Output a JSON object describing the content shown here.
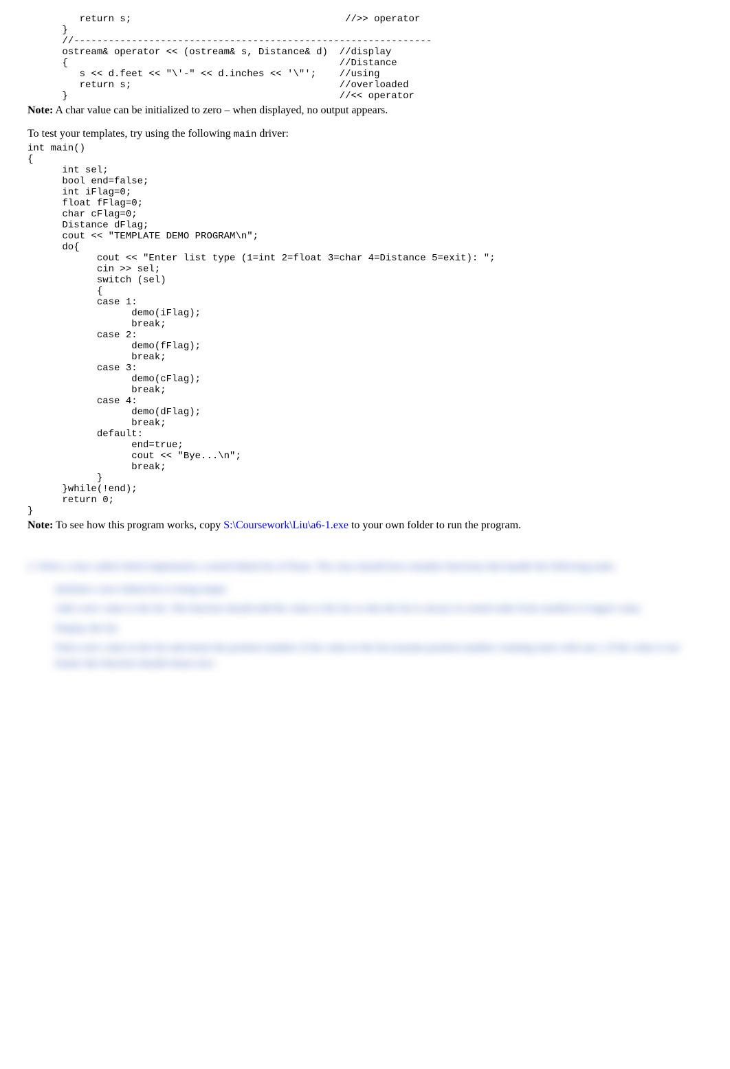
{
  "code_block1": "         return s;                                     //>> operator\n      }\n      //--------------------------------------------------------------\n      ostream& operator << (ostream& s, Distance& d)  //display\n      {                                               //Distance\n         s << d.feet << \"\\'-\" << d.inches << '\\\"';    //using\n         return s;                                    //overloaded\n      }                                               //<< operator",
  "note1_prefix": "Note:",
  "note1_body": "  A char value can be initialized to zero – when displayed, no output appears.",
  "prose1_a": "To test your templates, try using the following ",
  "prose1_code": "main",
  "prose1_b": " driver:",
  "code_block2": "int main()\n{\n      int sel;\n      bool end=false;\n      int iFlag=0;\n      float fFlag=0;\n      char cFlag=0;\n      Distance dFlag;\n      cout << \"TEMPLATE DEMO PROGRAM\\n\";\n      do{\n            cout << \"Enter list type (1=int 2=float 3=char 4=Distance 5=exit): \";\n            cin >> sel;\n            switch (sel)\n            {\n            case 1:\n                  demo(iFlag);\n                  break;\n            case 2:\n                  demo(fFlag);\n                  break;\n            case 3:\n                  demo(cFlag);\n                  break;\n            case 4:\n                  demo(dFlag);\n                  break;\n            default:\n                  end=true;\n                  cout << \"Bye...\\n\";\n                  break;\n            }\n      }while(!end);\n      return 0;\n}",
  "note2_prefix": "Note:",
  "note2_body_a": "  To see how this program works, copy  ",
  "note2_link": "S:\\Coursework\\Liu\\a6-1.exe",
  "note2_body_b": " to your own folder to run the program.",
  "blurred": {
    "p1": "2. Write a  class  called       which implements a sorted  linked list of floats.  The class should have member functions that handle the following tasks:",
    "b1": "Initialize a new linked list to being empty",
    "b2": "Add a new   value to the list.  The function should add the value to the list so that the list is always in sorted order from smallest to largest value.",
    "b3": "Display the list",
    "b4": "Find a new    value in the list and return the position number   of the value in the list (assume position number counting starts with one    ). If the  value is not found, this function should return zero."
  }
}
